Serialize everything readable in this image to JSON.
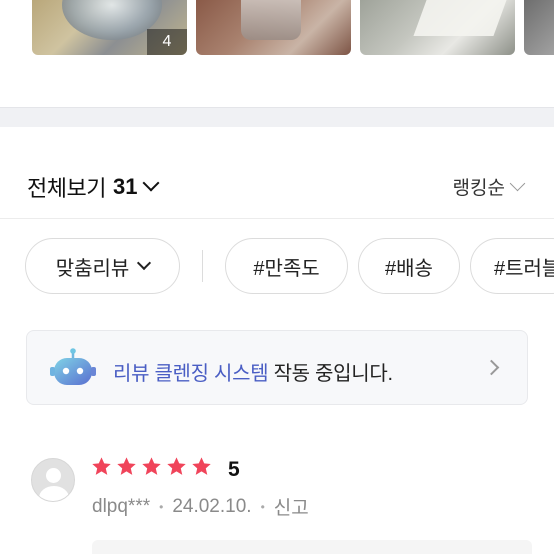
{
  "photos": {
    "more_count": "4"
  },
  "list_header": {
    "view_all_label": "전체보기",
    "review_count": "31",
    "sort_label": "랭킹순"
  },
  "filters": {
    "custom_label": "맞춤리뷰",
    "tags": [
      "#만족도",
      "#배송",
      "#트러블"
    ]
  },
  "cleansing_banner": {
    "highlight": "리뷰 클렌징 시스템",
    "rest": " 작동 중입니다.",
    "accent_color": "#4a5ec4"
  },
  "review": {
    "stars": 5,
    "rating": "5",
    "star_color": "#f0445a",
    "author": "dlpq***",
    "date": "24.02.10.",
    "report_label": "신고"
  }
}
